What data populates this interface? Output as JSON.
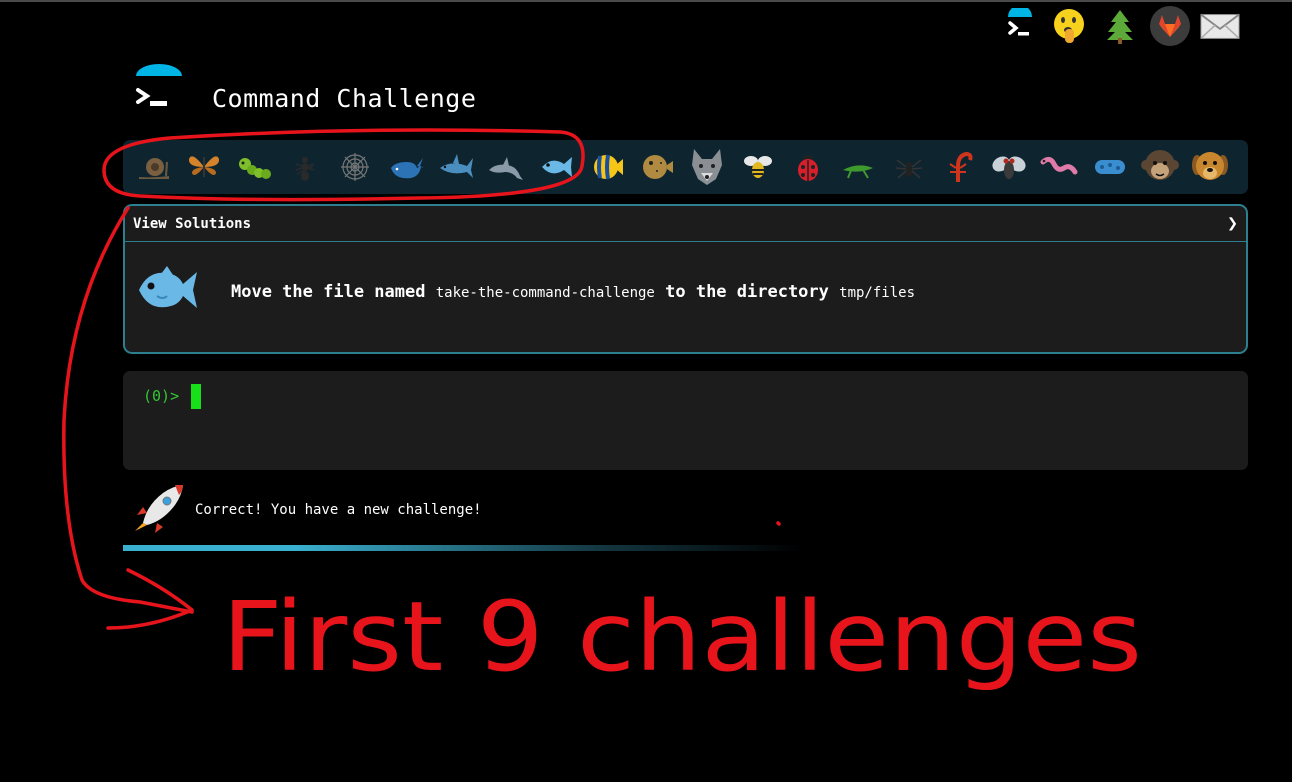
{
  "app": {
    "title": "Command Challenge"
  },
  "top_icons": [
    "terminal-icon",
    "shushing-face-icon",
    "evergreen-tree-icon",
    "gitlab-icon",
    "envelope-icon"
  ],
  "challenge_icons": [
    "snail",
    "butterfly",
    "caterpillar",
    "ant",
    "spider-web",
    "whale",
    "shark",
    "dolphin",
    "fish",
    "tropical-fish",
    "blowfish",
    "wolf",
    "bee",
    "ladybug",
    "cricket",
    "spider",
    "scorpion",
    "fly",
    "worm",
    "microbe",
    "monkey",
    "dog"
  ],
  "solutions_panel": {
    "header": "View Solutions",
    "expand_glyph": "❯",
    "task": {
      "prefix": "Move the file named",
      "filename": "take-the-command-challenge",
      "middle": "to the directory",
      "directory": "tmp/files"
    }
  },
  "terminal": {
    "prompt": "(0)>"
  },
  "status": {
    "message": "Correct! You have a new challenge!"
  },
  "annotation": {
    "text": "First 9 challenges",
    "color": "#e8141c"
  },
  "colors": {
    "accent": "#00b4e6",
    "terminal_green": "#18e018",
    "panel_border": "#2d7f8f"
  }
}
